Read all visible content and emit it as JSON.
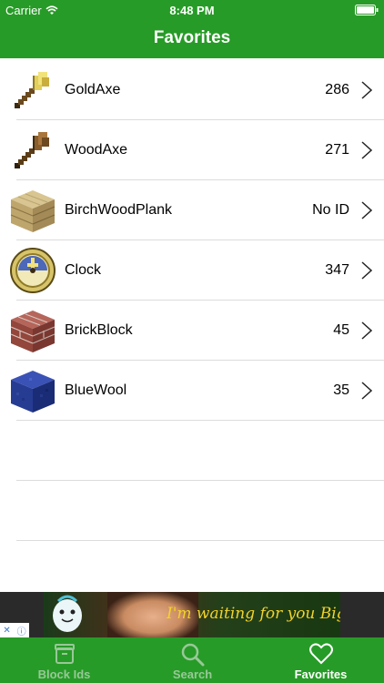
{
  "status_bar": {
    "carrier": "Carrier",
    "time": "8:48 PM"
  },
  "nav": {
    "title": "Favorites"
  },
  "favorites": [
    {
      "name": "GoldAxe",
      "id": "286",
      "icon": "gold-axe-icon"
    },
    {
      "name": "WoodAxe",
      "id": "271",
      "icon": "wood-axe-icon"
    },
    {
      "name": "BirchWoodPlank",
      "id": "No ID",
      "icon": "birch-wood-plank-icon"
    },
    {
      "name": "Clock",
      "id": "347",
      "icon": "clock-icon"
    },
    {
      "name": "BrickBlock",
      "id": "45",
      "icon": "brick-block-icon"
    },
    {
      "name": "BlueWool",
      "id": "35",
      "icon": "blue-wool-icon"
    }
  ],
  "ad": {
    "text": "I'm waiting for you Bigo!"
  },
  "tabs": [
    {
      "label": "Block Ids",
      "icon": "box-icon",
      "active": false
    },
    {
      "label": "Search",
      "icon": "search-icon",
      "active": false
    },
    {
      "label": "Favorites",
      "icon": "heart-icon",
      "active": true
    }
  ],
  "colors": {
    "brand_green": "#279b27",
    "inactive_tab": "#98c898",
    "separator": "#dcdcdc"
  }
}
